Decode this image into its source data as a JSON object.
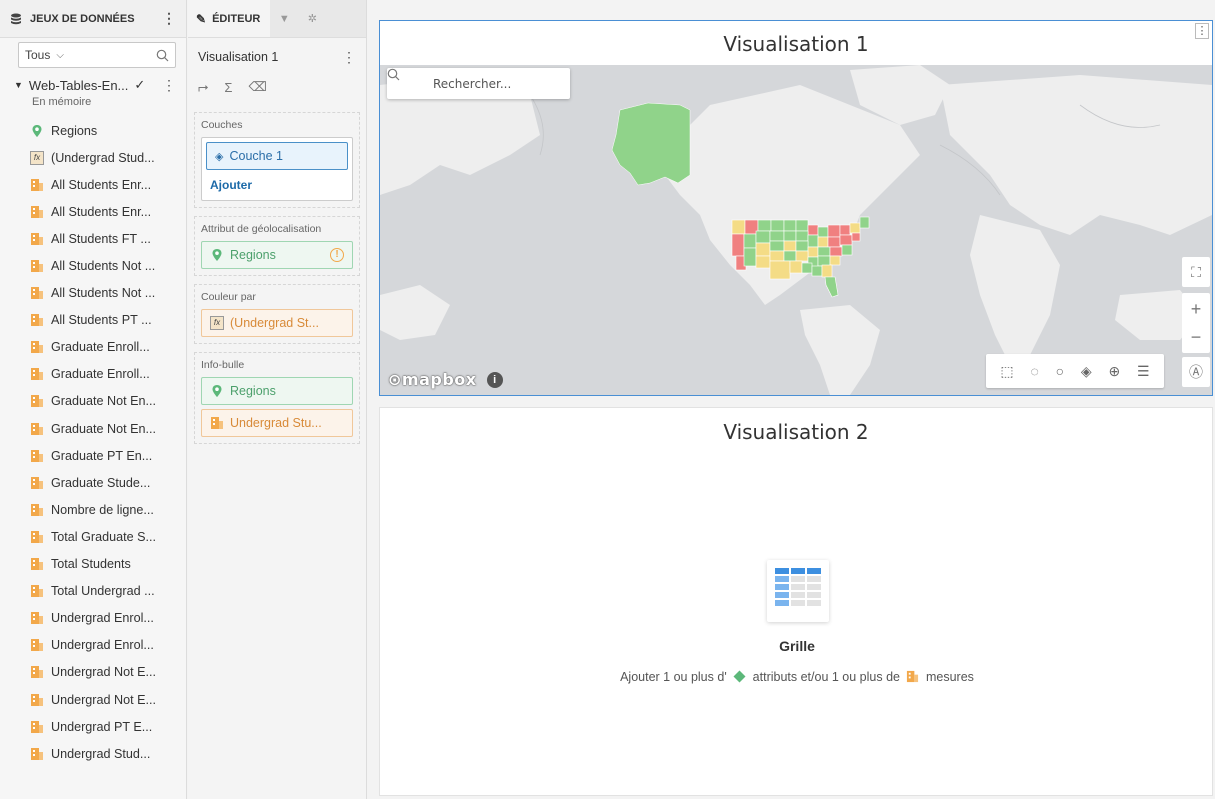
{
  "datasets_panel": {
    "header": "JEUX DE DONNÉES",
    "filter_value": "Tous",
    "dataset": {
      "name": "Web-Tables-En...",
      "status": "En mémoire"
    },
    "items": [
      {
        "label": "Regions",
        "kind": "geo"
      },
      {
        "label": "(Undergrad Stud...",
        "kind": "fx"
      },
      {
        "label": "All Students Enr...",
        "kind": "measure"
      },
      {
        "label": "All Students Enr...",
        "kind": "measure"
      },
      {
        "label": "All Students FT ...",
        "kind": "measure"
      },
      {
        "label": "All Students Not ...",
        "kind": "measure"
      },
      {
        "label": "All Students Not ...",
        "kind": "measure"
      },
      {
        "label": "All Students PT ...",
        "kind": "measure"
      },
      {
        "label": "Graduate Enroll...",
        "kind": "measure"
      },
      {
        "label": "Graduate Enroll...",
        "kind": "measure"
      },
      {
        "label": "Graduate Not En...",
        "kind": "measure"
      },
      {
        "label": "Graduate Not En...",
        "kind": "measure"
      },
      {
        "label": "Graduate PT En...",
        "kind": "measure"
      },
      {
        "label": "Graduate Stude...",
        "kind": "measure"
      },
      {
        "label": "Nombre de ligne...",
        "kind": "measure"
      },
      {
        "label": "Total Graduate S...",
        "kind": "measure"
      },
      {
        "label": "Total Students",
        "kind": "measure"
      },
      {
        "label": "Total Undergrad ...",
        "kind": "measure"
      },
      {
        "label": "Undergrad Enrol...",
        "kind": "measure"
      },
      {
        "label": "Undergrad Enrol...",
        "kind": "measure"
      },
      {
        "label": "Undergrad Not E...",
        "kind": "measure"
      },
      {
        "label": "Undergrad Not E...",
        "kind": "measure"
      },
      {
        "label": "Undergrad PT E...",
        "kind": "measure"
      },
      {
        "label": "Undergrad Stud...",
        "kind": "measure"
      }
    ]
  },
  "editor": {
    "tab_label": "ÉDITEUR",
    "viz_name": "Visualisation 1",
    "sections": {
      "layers_title": "Couches",
      "layer_name": "Couche 1",
      "add_label": "Ajouter",
      "geo_title": "Attribut de géolocalisation",
      "geo_value": "Regions",
      "color_title": "Couleur par",
      "color_value": "(Undergrad St...",
      "tooltip_title": "Info-bulle",
      "tooltip_values": [
        "Regions",
        "Undergrad Stu..."
      ]
    }
  },
  "viz1": {
    "title": "Visualisation 1",
    "search_placeholder": "Rechercher...",
    "attribution": "mapbox"
  },
  "viz2": {
    "title": "Visualisation 2",
    "grid_label": "Grille",
    "hint_part1": "Ajouter 1 ou plus d'",
    "hint_part2": "attributs et/ou 1 ou plus de",
    "hint_part3": "mesures"
  },
  "colors": {
    "accent": "#4a8fd4",
    "attribute_green": "#5cb87a",
    "measure_orange": "#f2a84a",
    "map_red": "#f08080",
    "map_yellow": "#f4dc86",
    "map_green": "#90d38a"
  }
}
